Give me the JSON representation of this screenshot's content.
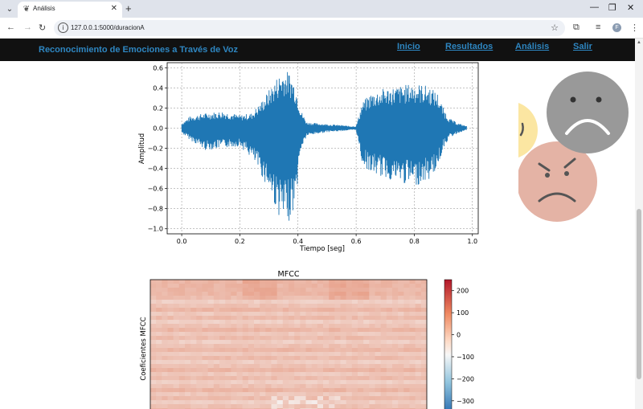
{
  "browser": {
    "tab_title": "Análisis",
    "url": "127.0.0.1:5000/duracionA",
    "profile_initial": "F"
  },
  "nav": {
    "brand": "Reconocimiento de Emociones a Través de Voz",
    "links": [
      "Inicio",
      "Resultados",
      "Análisis",
      "Salir"
    ]
  },
  "waveform": {
    "xlabel": "Tiempo [seg]",
    "ylabel": "Amplitud",
    "xticks": [
      "0.0",
      "0.2",
      "0.4",
      "0.6",
      "0.8",
      "1.0"
    ],
    "yticks": [
      "0.6",
      "0.4",
      "0.2",
      "0.0",
      "−0.2",
      "−0.4",
      "−0.6",
      "−0.8",
      "−1.0"
    ],
    "color": "#1f77b4"
  },
  "mfcc": {
    "title": "MFCC",
    "ylabel": "Coeficientes MFCC",
    "colorbar_ticks": [
      "200",
      "100",
      "0",
      "−100",
      "−200",
      "−300"
    ]
  },
  "chart_data": {
    "type": "line",
    "xlim": [
      -0.05,
      1.02
    ],
    "ylim": [
      -1.05,
      0.65
    ],
    "grid": true,
    "envelope": {
      "x": [
        0.0,
        0.03,
        0.08,
        0.14,
        0.2,
        0.24,
        0.27,
        0.3,
        0.33,
        0.35,
        0.37,
        0.39,
        0.41,
        0.43,
        0.46,
        0.5,
        0.55,
        0.58,
        0.6,
        0.62,
        0.65,
        0.7,
        0.75,
        0.8,
        0.85,
        0.88,
        0.9,
        0.92,
        0.95,
        0.98
      ],
      "upper": [
        0.05,
        0.12,
        0.15,
        0.17,
        0.13,
        0.15,
        0.25,
        0.38,
        0.52,
        0.58,
        0.56,
        0.45,
        0.18,
        0.06,
        0.05,
        0.04,
        0.03,
        0.02,
        0.02,
        0.25,
        0.35,
        0.4,
        0.42,
        0.45,
        0.42,
        0.35,
        0.2,
        0.1,
        0.05,
        0.02
      ],
      "lower": [
        -0.05,
        -0.12,
        -0.22,
        -0.2,
        -0.18,
        -0.3,
        -0.45,
        -0.62,
        -0.85,
        -0.95,
        -0.92,
        -0.78,
        -0.22,
        -0.08,
        -0.06,
        -0.04,
        -0.03,
        -0.02,
        -0.02,
        -0.35,
        -0.45,
        -0.5,
        -0.55,
        -0.58,
        -0.52,
        -0.4,
        -0.2,
        -0.1,
        -0.05,
        -0.02
      ]
    }
  }
}
